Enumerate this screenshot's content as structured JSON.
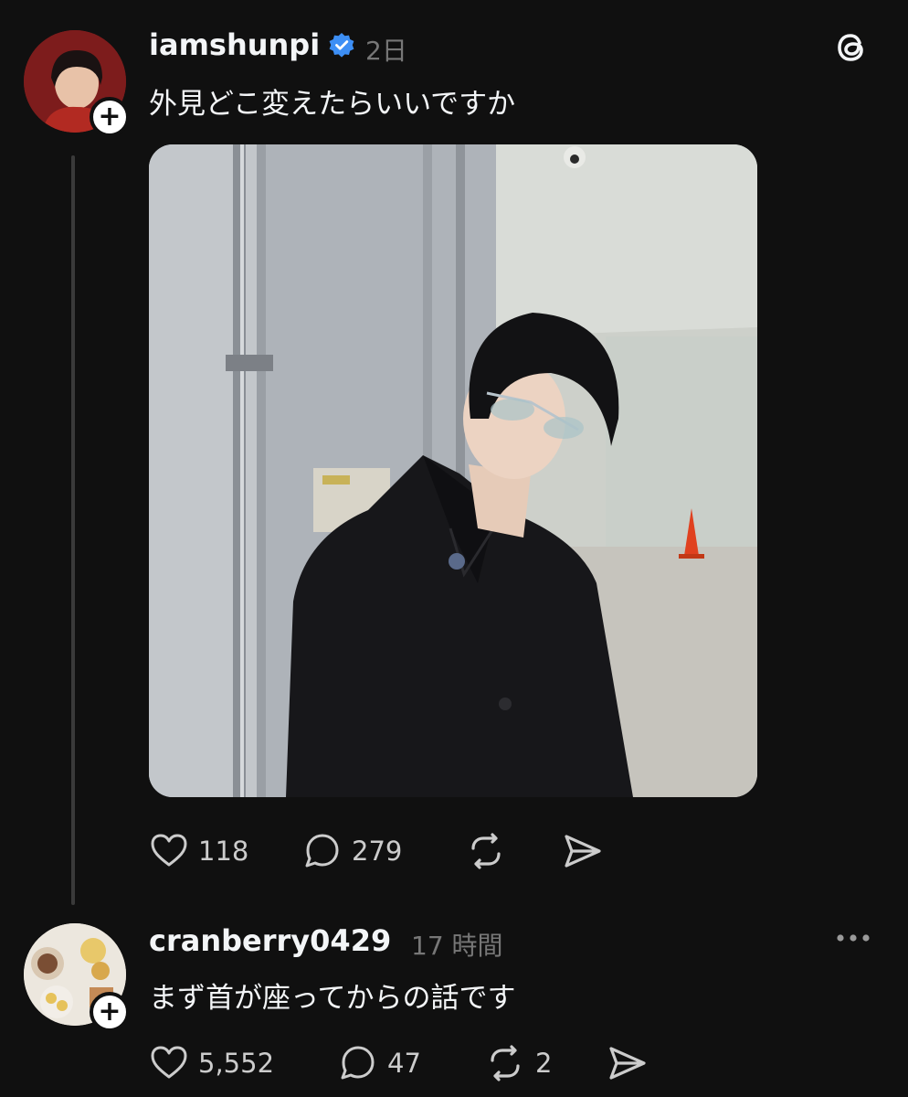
{
  "post": {
    "username": "iamshunpi",
    "time": "2日",
    "text": "外見どこ変えたらいいですか",
    "likes": "118",
    "replies": "279"
  },
  "reply": {
    "username": "cranberry0429",
    "time": "17 時間",
    "text": "まず首が座ってからの話です",
    "likes": "5,552",
    "replies": "47",
    "reposts": "2"
  },
  "icons": {
    "verified_color": "#3d8ff5",
    "brand": "threads-logo-icon"
  }
}
